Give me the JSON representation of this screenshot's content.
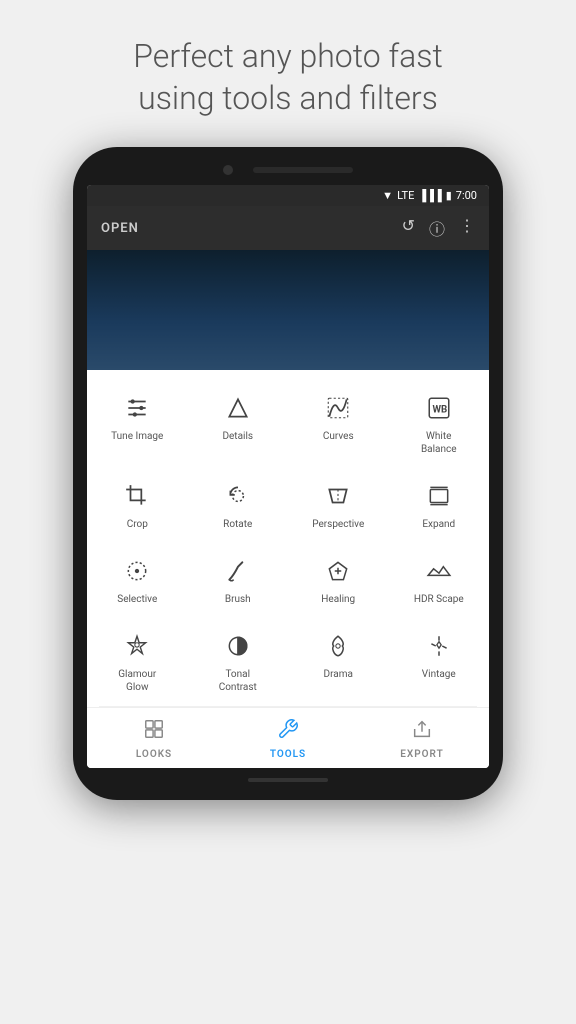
{
  "headline": "Perfect any photo fast\nusing tools and filters",
  "status_bar": {
    "time": "7:00",
    "battery": "🔋",
    "signal": "LTE"
  },
  "app_bar": {
    "open_label": "OPEN"
  },
  "tools": [
    {
      "id": "tune-image",
      "label": "Tune Image",
      "icon": "tune"
    },
    {
      "id": "details",
      "label": "Details",
      "icon": "details"
    },
    {
      "id": "curves",
      "label": "Curves",
      "icon": "curves"
    },
    {
      "id": "white-balance",
      "label": "White\nBalance",
      "icon": "wb"
    },
    {
      "id": "crop",
      "label": "Crop",
      "icon": "crop"
    },
    {
      "id": "rotate",
      "label": "Rotate",
      "icon": "rotate"
    },
    {
      "id": "perspective",
      "label": "Perspective",
      "icon": "perspective"
    },
    {
      "id": "expand",
      "label": "Expand",
      "icon": "expand"
    },
    {
      "id": "selective",
      "label": "Selective",
      "icon": "selective"
    },
    {
      "id": "brush",
      "label": "Brush",
      "icon": "brush"
    },
    {
      "id": "healing",
      "label": "Healing",
      "icon": "healing"
    },
    {
      "id": "hdr-scape",
      "label": "HDR Scape",
      "icon": "hdr"
    },
    {
      "id": "glamour-glow",
      "label": "Glamour\nGlow",
      "icon": "glamour"
    },
    {
      "id": "tonal-contrast",
      "label": "Tonal\nContrast",
      "icon": "tonal"
    },
    {
      "id": "drama",
      "label": "Drama",
      "icon": "drama"
    },
    {
      "id": "vintage",
      "label": "Vintage",
      "icon": "vintage"
    }
  ],
  "bottom_nav": [
    {
      "id": "looks",
      "label": "LOOKS",
      "icon": "looks",
      "active": false
    },
    {
      "id": "tools",
      "label": "TOOLS",
      "icon": "tools",
      "active": true
    },
    {
      "id": "export",
      "label": "EXPORT",
      "icon": "export",
      "active": false
    }
  ]
}
